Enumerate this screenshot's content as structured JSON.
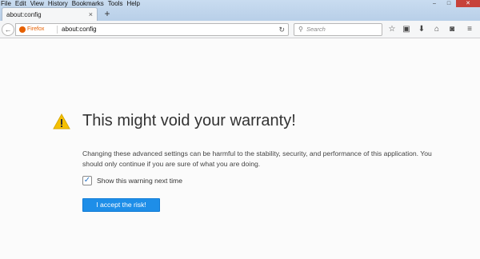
{
  "menu": [
    "File",
    "Edit",
    "View",
    "History",
    "Bookmarks",
    "Tools",
    "Help"
  ],
  "window_controls": {
    "minimize": "–",
    "maximize": "□",
    "close": "✕"
  },
  "tab": {
    "title": "about:config",
    "close": "×"
  },
  "new_tab": "+",
  "nav": {
    "back": "←",
    "identity_label": "Firefox",
    "url": "about:config",
    "reload": "↻",
    "search_placeholder": "Search",
    "search_icon": "🔍",
    "toolbar_icons": [
      {
        "name": "bookmark-star-icon",
        "glyph": "☆"
      },
      {
        "name": "reading-list-icon",
        "glyph": "▣"
      },
      {
        "name": "downloads-icon",
        "glyph": "⬇"
      },
      {
        "name": "home-icon",
        "glyph": "⌂"
      },
      {
        "name": "pocket-icon",
        "glyph": "◙"
      },
      {
        "name": "menu-icon",
        "glyph": "≡"
      }
    ]
  },
  "content": {
    "title": "This might void your warranty!",
    "description": "Changing these advanced settings can be harmful to the stability, security, and performance of this application. You should only continue if you are sure of what you are doing.",
    "checkbox_checked": true,
    "checkbox_mark": "✓",
    "checkbox_label": "Show this warning next time",
    "accept_button": "I accept the risk!"
  },
  "colors": {
    "accent": "#1e8ee8",
    "warning": "#f5c000",
    "firefox": "#e66000"
  }
}
